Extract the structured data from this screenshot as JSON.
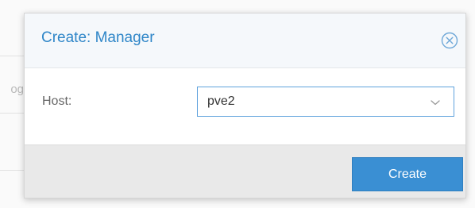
{
  "background": {
    "partial_text": "og"
  },
  "dialog": {
    "title": "Create: Manager",
    "close_icon": "close-circle-icon",
    "form": {
      "host_label": "Host:",
      "host_value": "pve2",
      "dropdown_icon": "chevron-down-icon"
    },
    "footer": {
      "create_label": "Create"
    }
  },
  "colors": {
    "title": "#2f86c8",
    "primary_button": "#3a8fd3",
    "input_focus_border": "#5fa2dd",
    "footer_bg": "#e9e9e9",
    "header_bg": "#f5f8fb"
  }
}
